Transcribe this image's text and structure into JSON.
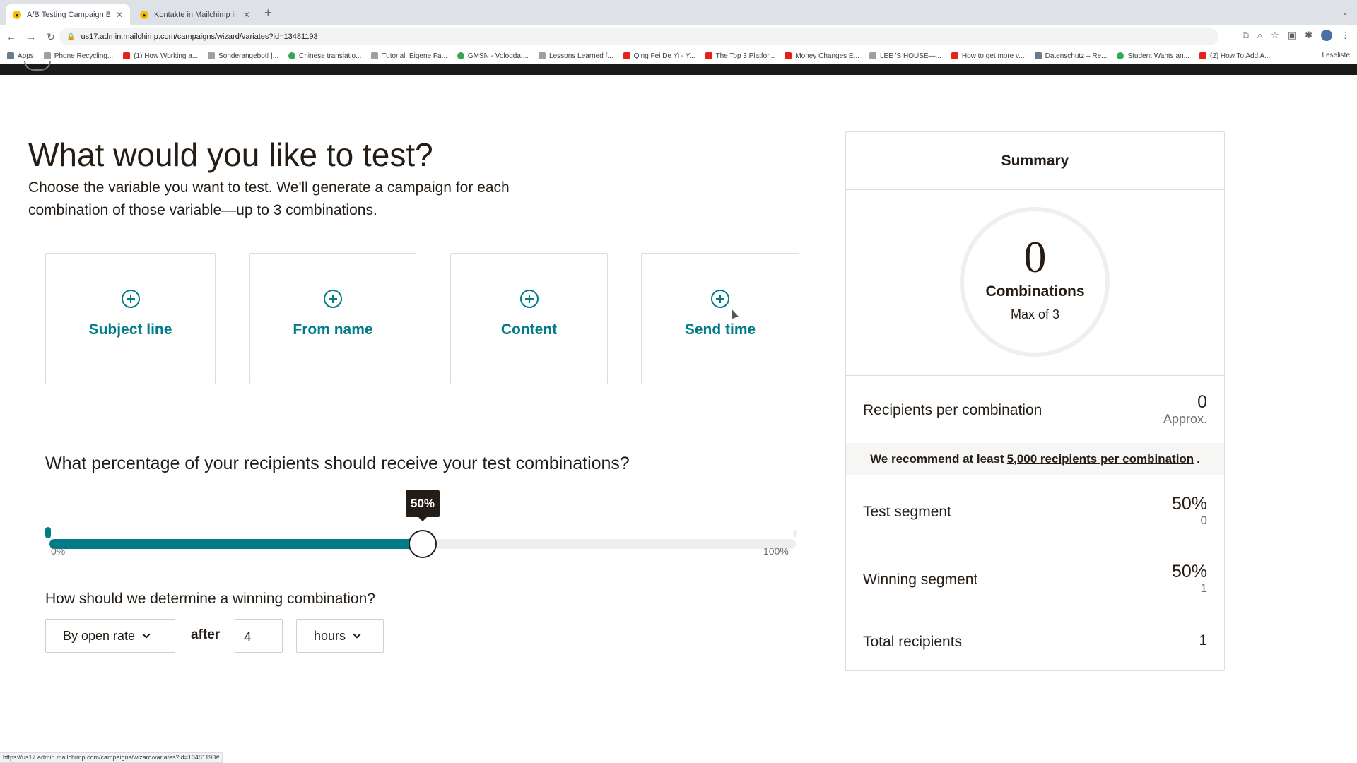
{
  "browser": {
    "tabs": [
      {
        "label": "A/B Testing Campaign Builder",
        "active": true
      },
      {
        "label": "Kontakte in Mailchimp importi",
        "active": false
      }
    ],
    "url": "us17.admin.mailchimp.com/campaigns/wizard/variates?id=13481193",
    "bookmarks": [
      {
        "label": "Apps",
        "icon": "apps-grid-icon"
      },
      {
        "label": "Phone Recycling...",
        "icon": "search-icon"
      },
      {
        "label": "(1) How Working a...",
        "icon": "youtube-icon"
      },
      {
        "label": "Sonderangebot! |...",
        "icon": "globe-icon"
      },
      {
        "label": "Chinese translatio...",
        "icon": "globe-icon"
      },
      {
        "label": "Tutorial: Eigene Fa...",
        "icon": "hash-icon"
      },
      {
        "label": "GMSN - Vologda,...",
        "icon": "globe-icon"
      },
      {
        "label": "Lessons Learned f...",
        "icon": "link-icon"
      },
      {
        "label": "Qing Fei De Yi - Y...",
        "icon": "youtube-icon"
      },
      {
        "label": "The Top 3 Platfor...",
        "icon": "youtube-icon"
      },
      {
        "label": "Money Changes E...",
        "icon": "youtube-icon"
      },
      {
        "label": "LEE 'S HOUSE—...",
        "icon": "house-icon"
      },
      {
        "label": "How to get more v...",
        "icon": "youtube-icon"
      },
      {
        "label": "Datenschutz – Re...",
        "icon": "doc-icon"
      },
      {
        "label": "Student Wants an...",
        "icon": "globe-icon"
      },
      {
        "label": "(2) How To Add A...",
        "icon": "youtube-icon"
      }
    ],
    "reading_list": "Leseliste",
    "status_url": "https://us17.admin.mailchimp.com/campaigns/wizard/variates?id=13481193#"
  },
  "main": {
    "title": "What would you like to test?",
    "subtitle": "Choose the variable you want to test. We'll generate a campaign for each combination of those variable—up to 3 combinations.",
    "variables": [
      {
        "label": "Subject line",
        "icon": "plus-circle-icon"
      },
      {
        "label": "From name",
        "icon": "plus-circle-icon"
      },
      {
        "label": "Content",
        "icon": "plus-circle-icon"
      },
      {
        "label": "Send time",
        "icon": "plus-circle-icon"
      }
    ],
    "percentage_question": "What percentage of your recipients should receive your test combinations?",
    "slider": {
      "value": 50,
      "value_label": "50%",
      "min_label": "0%",
      "max_label": "100%"
    },
    "winning_question": "How should we determine a winning combination?",
    "winning_metric": "By open rate",
    "after_label": "after",
    "duration_value": "4",
    "duration_unit": "hours"
  },
  "summary": {
    "title": "Summary",
    "combinations_count": "0",
    "combinations_label": "Combinations",
    "max_label": "Max of 3",
    "recipients_per_combination_label": "Recipients per combination",
    "recipients_per_combination_value": "0",
    "approx_label": "Approx.",
    "recommend_prefix": "We recommend at least",
    "recommend_link": "5,000 recipients per combination",
    "recommend_suffix": ".",
    "test_segment_label": "Test segment",
    "test_segment_pct": "50%",
    "test_segment_count": "0",
    "winning_segment_label": "Winning segment",
    "winning_segment_pct": "50%",
    "winning_segment_count": "1",
    "total_recipients_label": "Total recipients",
    "total_recipients_value": "1"
  },
  "colors": {
    "accent": "#007c89",
    "text": "#241c15",
    "appbar": "#1a1a1a"
  }
}
